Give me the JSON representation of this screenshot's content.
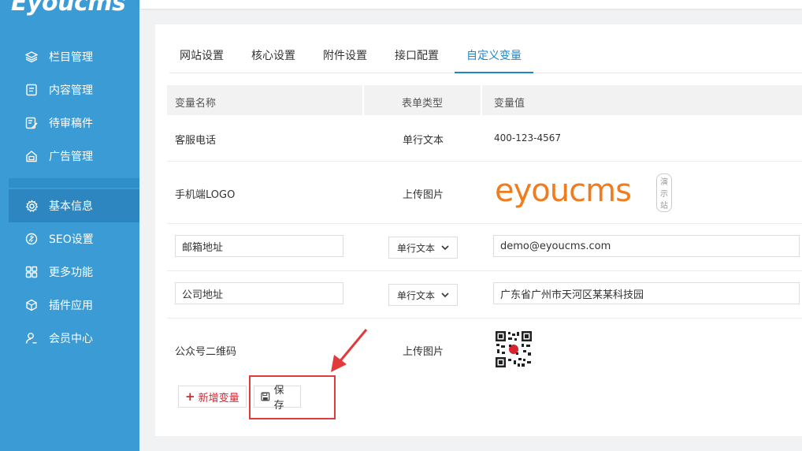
{
  "brand": {
    "logo_text": "Eyoucms"
  },
  "sidebar": {
    "items": [
      {
        "label": "栏目管理",
        "icon": "layers-icon"
      },
      {
        "label": "内容管理",
        "icon": "document-icon"
      },
      {
        "label": "待审稿件",
        "icon": "edit-document-icon"
      },
      {
        "label": "广告管理",
        "icon": "home-ad-icon"
      },
      {
        "label": "基本信息",
        "icon": "gear-icon"
      },
      {
        "label": "SEO设置",
        "icon": "link-icon"
      },
      {
        "label": "更多功能",
        "icon": "grid-icon"
      },
      {
        "label": "插件应用",
        "icon": "cube-icon"
      },
      {
        "label": "会员中心",
        "icon": "user-icon"
      }
    ],
    "active_label": "基本信息"
  },
  "tabs": [
    "网站设置",
    "核心设置",
    "附件设置",
    "接口配置",
    "自定义变量"
  ],
  "active_tab": "自定义变量",
  "table": {
    "headers": [
      "变量名称",
      "表单类型",
      "变量值"
    ],
    "rows": [
      {
        "name": "客服电话",
        "type": "单行文本",
        "value": "400-123-4567"
      },
      {
        "name": "手机端LOGO",
        "type": "上传图片",
        "value_logo": "eyoucms",
        "value_badge": "演示站"
      },
      {
        "name": "邮箱地址",
        "type": "单行文本",
        "value": "demo@eyoucms.com"
      },
      {
        "name": "公司地址",
        "type": "单行文本",
        "value": "广东省广州市天河区某某科技园"
      },
      {
        "name": "公众号二维码",
        "type": "上传图片",
        "value_icon": "qrcode-icon"
      }
    ]
  },
  "actions": {
    "add_label": "新增变量",
    "save_label": "保存"
  },
  "colors": {
    "sidebar": "#3a9bd5",
    "accent": "#1e88c7",
    "annotation": "#e03a3a"
  }
}
